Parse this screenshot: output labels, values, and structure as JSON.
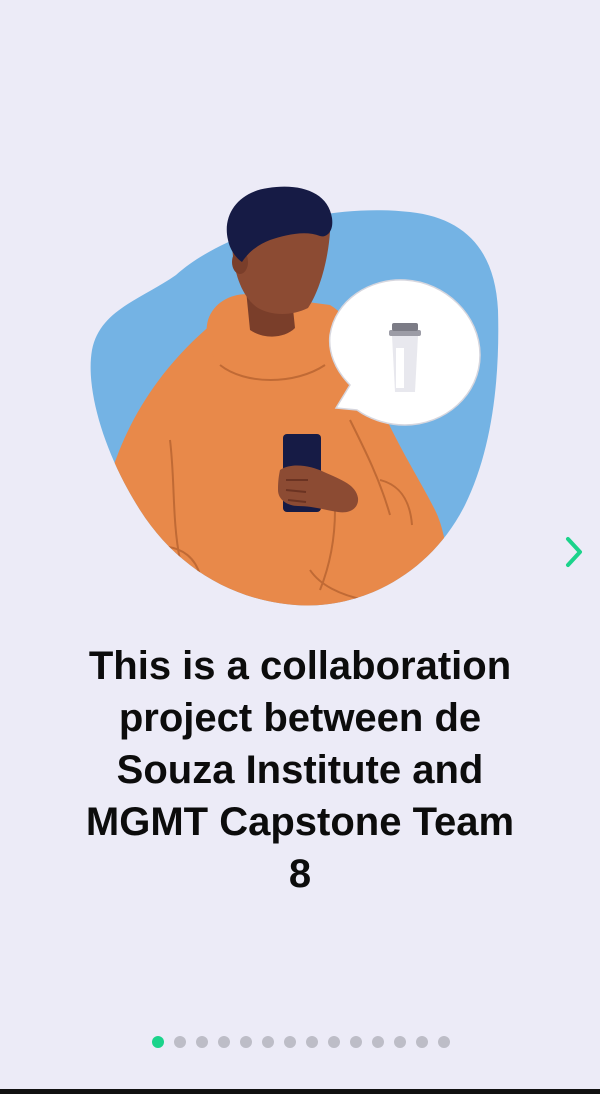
{
  "onboarding": {
    "headline": "This is a collaboration project between de Souza Institute and MGMT Capstone Team 8",
    "next_icon": "chevron-right-icon",
    "illustration": "person-with-phone-speech-bubble-illustration"
  },
  "pager": {
    "total_pages": 14,
    "current_page": 1
  },
  "colors": {
    "background": "#ECEBF7",
    "accent": "#1BD38B",
    "dot_inactive": "#BDBDC7",
    "blob": "#74B3E4",
    "hoodie": "#E8894A",
    "skin": "#8C4B33",
    "hair": "#161B45",
    "text": "#0C0C0C"
  }
}
